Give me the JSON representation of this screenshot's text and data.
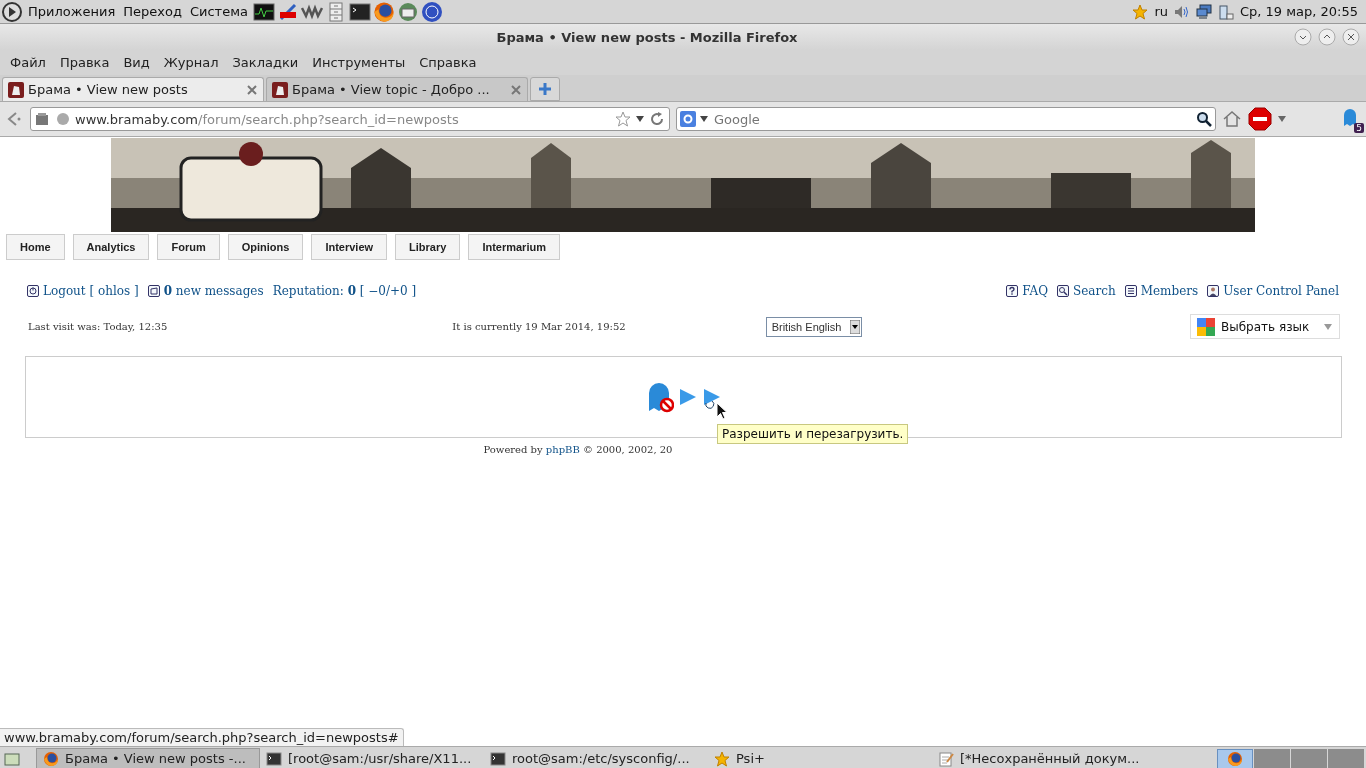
{
  "top_panel": {
    "menus": [
      "Приложения",
      "Переход",
      "Система"
    ],
    "keyboard_layout": "ru",
    "clock": "Ср, 19 мар, 20:55"
  },
  "window": {
    "title": "Брама • View new posts - Mozilla Firefox"
  },
  "menubar": [
    "Файл",
    "Правка",
    "Вид",
    "Журнал",
    "Закладки",
    "Инструменты",
    "Справка"
  ],
  "tabs": [
    {
      "label": "Брама • View new posts",
      "selected": true
    },
    {
      "label": "Брама • View topic - Добро ...",
      "selected": false
    }
  ],
  "address_bar": {
    "domain": "www.bramaby.com",
    "path": "/forum/search.php?search_id=newposts"
  },
  "search_bar": {
    "placeholder": "Google"
  },
  "extension_badge": "5",
  "page": {
    "nav": [
      {
        "label": "Home"
      },
      {
        "label": "Analytics"
      },
      {
        "label": "Forum"
      },
      {
        "label": "Opinions"
      },
      {
        "label": "Interview"
      },
      {
        "label": "Library"
      },
      {
        "label": "Intermarium"
      }
    ],
    "user_links": [
      {
        "kind": "logout",
        "text": "Logout [ ohlos ]"
      },
      {
        "kind": "messages",
        "text": "**0** new messages"
      },
      {
        "kind": "reputation",
        "text": "Reputation: **0** [ −0/+0 ]"
      }
    ],
    "site_links": [
      {
        "kind": "faq",
        "label": "FAQ"
      },
      {
        "kind": "search",
        "label": "Search"
      },
      {
        "kind": "members",
        "label": "Members"
      },
      {
        "kind": "ucp",
        "label": "User Control Panel"
      }
    ],
    "last_visit": "Last visit was: Today, 12:35",
    "current_time": "It is currently 19 Mar 2014, 19:52",
    "language_select": {
      "value": "British English"
    },
    "translate_widget": {
      "label": "Выбрать язык"
    },
    "footer": {
      "prefix": "Powered by",
      "link": "phpBB",
      "suffix": "© 2000, 2002, 20"
    },
    "tooltip": "Разрешить и перезагрузить."
  },
  "status_link": "www.bramaby.com/forum/search.php?search_id=newposts#",
  "taskbar": [
    {
      "kind": "browser",
      "label": "Брама • View new posts -...",
      "selected": true
    },
    {
      "kind": "terminal",
      "label": "[root@sam:/usr/share/X11...",
      "selected": false
    },
    {
      "kind": "terminal",
      "label": "root@sam:/etc/sysconfig/...",
      "selected": false
    },
    {
      "kind": "star",
      "label": "Psi+",
      "selected": false
    },
    {
      "kind": "editor",
      "label": "[*Несохранённый докум...",
      "selected": false
    }
  ],
  "workspaces": [
    {
      "selected": true
    },
    {
      "selected": false
    },
    {
      "selected": false
    },
    {
      "selected": false
    }
  ]
}
